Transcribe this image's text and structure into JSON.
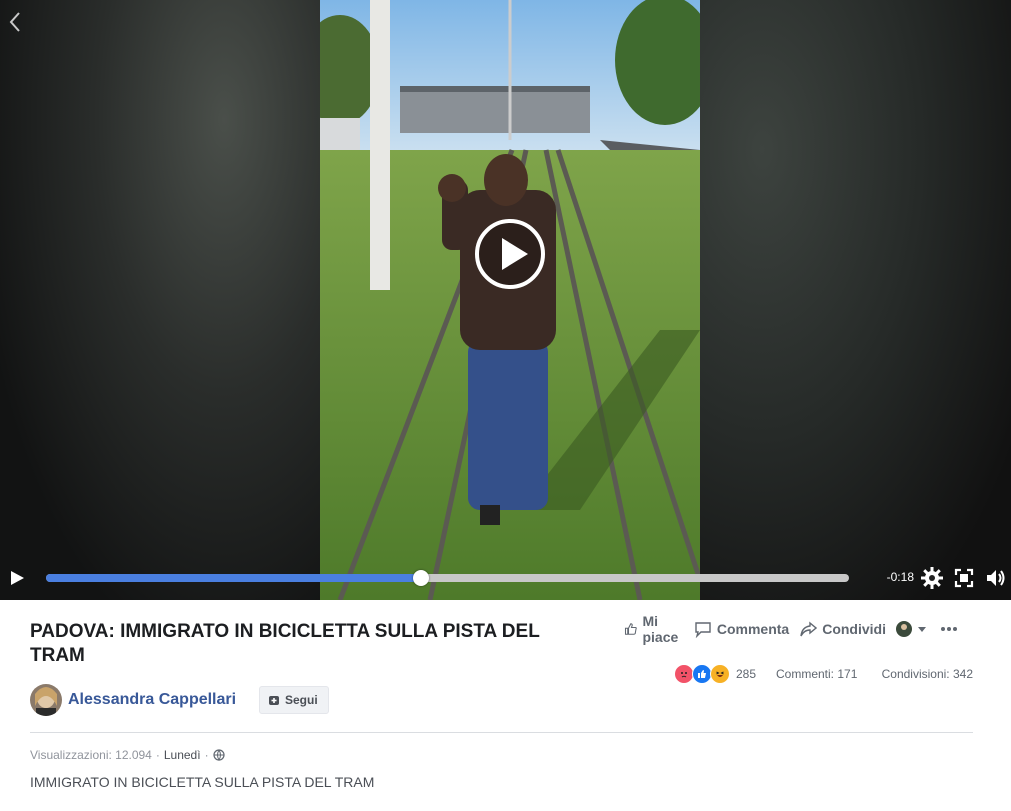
{
  "video": {
    "time_remaining": "-0:18",
    "progress_fraction": 0.467
  },
  "post": {
    "title": "PADOVA: IMMIGRATO IN BICICLETTA SULLA PISTA DEL TRAM",
    "author": "Alessandra Cappellari",
    "follow_label": "Segui",
    "actions": {
      "like": "Mi piace",
      "comment": "Commenta",
      "share": "Condividi"
    },
    "reaction_count": "285",
    "comments": "Commenti: 171",
    "shares": "Condivisioni: 342",
    "views": "Visualizzazioni: 12.094",
    "day": "Lunedì",
    "description": "IMMIGRATO IN BICICLETTA SULLA PISTA DEL TRAM"
  },
  "colors": {
    "accent": "#4a7fe0",
    "link": "#385898"
  }
}
